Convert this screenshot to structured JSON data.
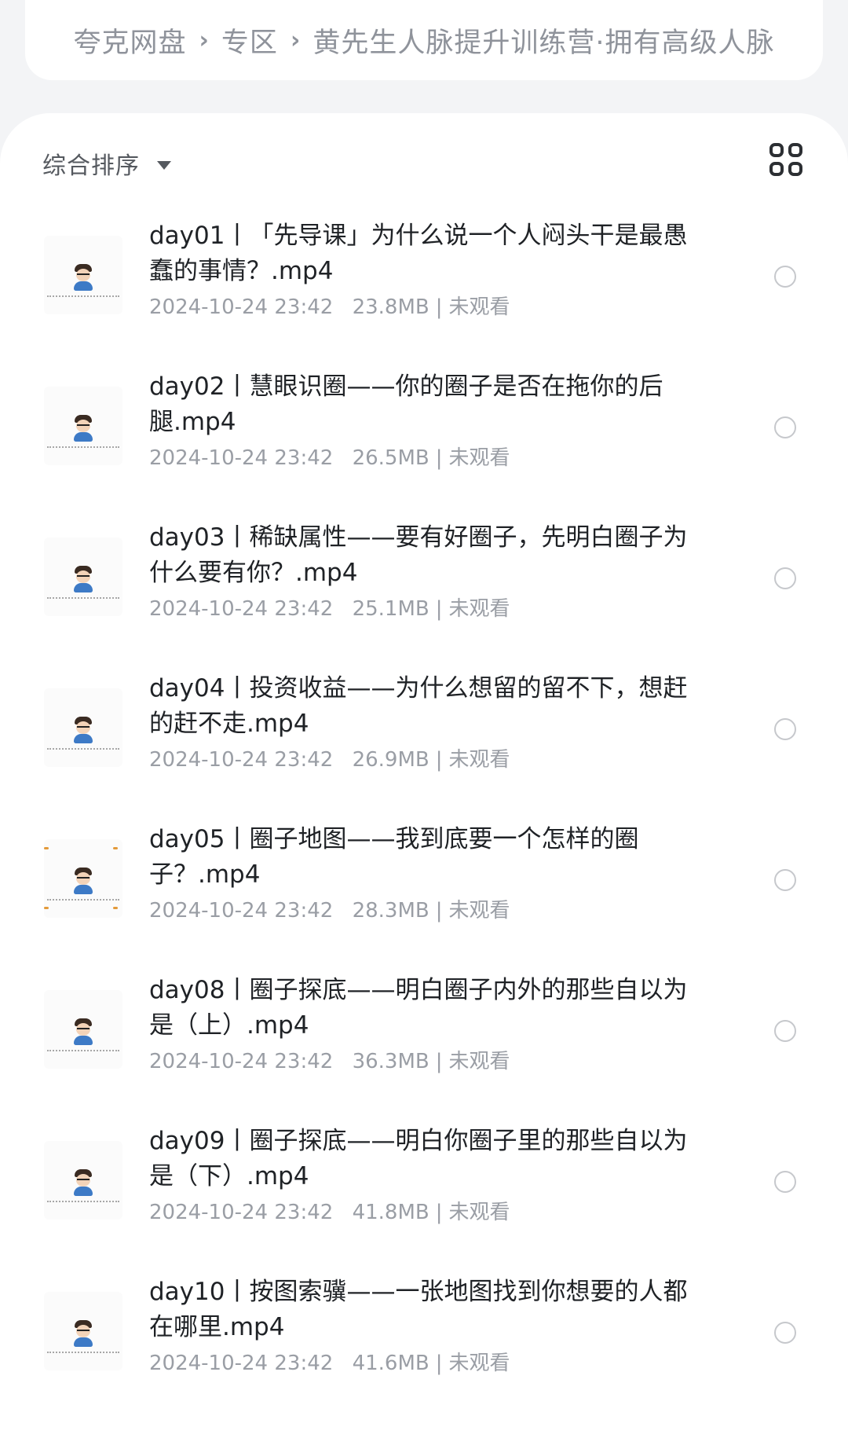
{
  "breadcrumb": {
    "items": [
      "夸克网盘",
      "专区",
      "黄先生人脉提升训练营·拥有高级人脉"
    ],
    "separator": "›"
  },
  "toolbar": {
    "sort_label": "综合排序",
    "sort_caret_icon": "caret-down-icon",
    "view_toggle_icon": "grid-view-icon"
  },
  "files": [
    {
      "name": "day01丨「先导课」为什么说一个人闷头干是最愚蠢的事情？.mp4",
      "date": "2024-10-24 23:42",
      "size": "23.8MB",
      "status": "未观看"
    },
    {
      "name": "day02丨慧眼识圈——你的圈子是否在拖你的后腿.mp4",
      "date": "2024-10-24 23:42",
      "size": "26.5MB",
      "status": "未观看"
    },
    {
      "name": "day03丨稀缺属性——要有好圈子，先明白圈子为什么要有你？.mp4",
      "date": "2024-10-24 23:42",
      "size": "25.1MB",
      "status": "未观看"
    },
    {
      "name": "day04丨投资收益——为什么想留的留不下，想赶的赶不走.mp4",
      "date": "2024-10-24 23:42",
      "size": "26.9MB",
      "status": "未观看"
    },
    {
      "name": "day05丨圈子地图——我到底要一个怎样的圈子？.mp4",
      "date": "2024-10-24 23:42",
      "size": "28.3MB",
      "status": "未观看"
    },
    {
      "name": "day08丨圈子探底——明白圈子内外的那些自以为是（上）.mp4",
      "date": "2024-10-24 23:42",
      "size": "36.3MB",
      "status": "未观看"
    },
    {
      "name": "day09丨圈子探底——明白你圈子里的那些自以为是（下）.mp4",
      "date": "2024-10-24 23:42",
      "size": "41.8MB",
      "status": "未观看"
    },
    {
      "name": "day10丨按图索骥——一张地图找到你想要的人都在哪里.mp4",
      "date": "2024-10-24 23:42",
      "size": "41.6MB",
      "status": "未观看"
    }
  ],
  "colors": {
    "background": "#f3f4f6",
    "panel": "#ffffff",
    "title_text": "#1f2226",
    "meta_text": "#9a9ea5",
    "breadcrumb_text": "#8f939b"
  }
}
